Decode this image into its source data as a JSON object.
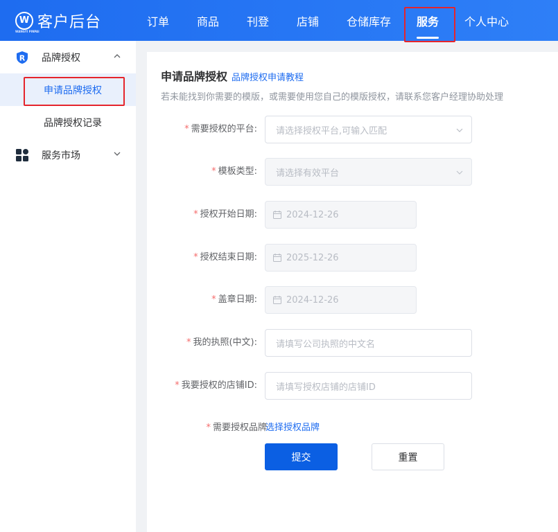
{
  "header": {
    "brand": "客户后台",
    "brand_sub": "WANGYI PINPAI",
    "nav": [
      "订单",
      "商品",
      "刊登",
      "店铺",
      "仓储库存",
      "服务",
      "个人中心"
    ],
    "active_nav": "服务"
  },
  "sidebar": {
    "groups": [
      {
        "label": "品牌授权",
        "icon": "brand-shield-icon",
        "expanded": true,
        "items": [
          "申请品牌授权",
          "品牌授权记录"
        ],
        "active_item": "申请品牌授权"
      },
      {
        "label": "服务市场",
        "icon": "apps-grid-icon",
        "expanded": false,
        "items": []
      }
    ]
  },
  "main": {
    "title": "申请品牌授权",
    "tutorial_link": "品牌授权申请教程",
    "hint": "若未能找到你需要的模版，或需要使用您自己的模版授权，请联系您客户经理协助处理",
    "form": {
      "required_mark": "*",
      "platform": {
        "label": "需要授权的平台:",
        "placeholder": "请选择授权平台,可输入匹配"
      },
      "template": {
        "label": "模板类型:",
        "placeholder": "请选择有效平台"
      },
      "start_date": {
        "label": "授权开始日期:",
        "value": "2024-12-26"
      },
      "end_date": {
        "label": "授权结束日期:",
        "value": "2025-12-26"
      },
      "seal_date": {
        "label": "盖章日期:",
        "value": "2024-12-26"
      },
      "license": {
        "label": "我的执照(中文):",
        "placeholder": "请填写公司执照的中文名"
      },
      "store_id": {
        "label": "我要授权的店铺ID:",
        "placeholder": "请填写授权店铺的店铺ID"
      },
      "brand": {
        "label": "需要授权品牌",
        "link": "选择授权品牌"
      },
      "submit": "提交",
      "reset": "重置"
    }
  },
  "colors": {
    "header_bg": "#1e6cf0",
    "accent": "#1e6cf0",
    "required": "#f56c6c",
    "highlight_box": "#e5242b"
  }
}
